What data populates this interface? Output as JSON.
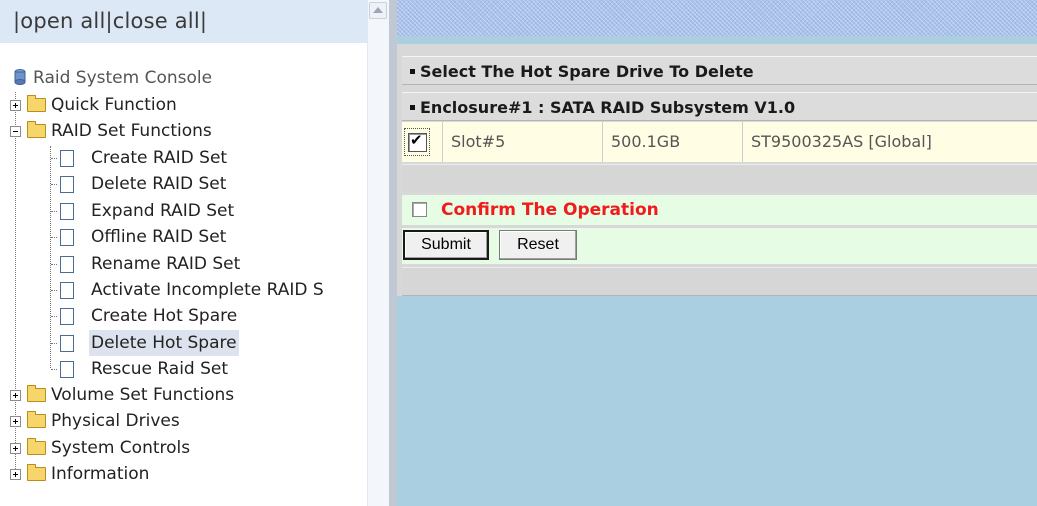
{
  "sidebar": {
    "toolbar_text": "|open all|close all|",
    "root": "Raid System Console",
    "items": [
      {
        "label": "Quick Function"
      },
      {
        "label": "RAID Set Functions"
      },
      {
        "label": "Volume Set Functions"
      },
      {
        "label": "Physical Drives"
      },
      {
        "label": "System Controls"
      },
      {
        "label": "Information"
      }
    ],
    "raid_set_children": [
      {
        "label": "Create RAID Set"
      },
      {
        "label": "Delete RAID Set"
      },
      {
        "label": "Expand RAID Set"
      },
      {
        "label": "Offline RAID Set"
      },
      {
        "label": "Rename RAID Set"
      },
      {
        "label": "Activate Incomplete RAID S"
      },
      {
        "label": "Create Hot Spare"
      },
      {
        "label": "Delete Hot Spare",
        "selected": true
      },
      {
        "label": "Rescue Raid Set"
      }
    ]
  },
  "main": {
    "section_title": "Select The Hot Spare Drive To Delete",
    "enclosure_title": "Enclosure#1 : SATA RAID Subsystem V1.0",
    "drives": [
      {
        "checked": true,
        "slot": "Slot#5",
        "capacity": "500.1GB",
        "model": "ST9500325AS [Global]"
      }
    ],
    "confirm_label": "Confirm The Operation",
    "confirm_checked": false,
    "submit_label": "Submit",
    "reset_label": "Reset"
  },
  "colors": {
    "content_background": "#a9cfe0",
    "confirm_text": "#f01b1b",
    "row_highlight": "#fffde3",
    "confirm_row": "#e6fce4"
  }
}
